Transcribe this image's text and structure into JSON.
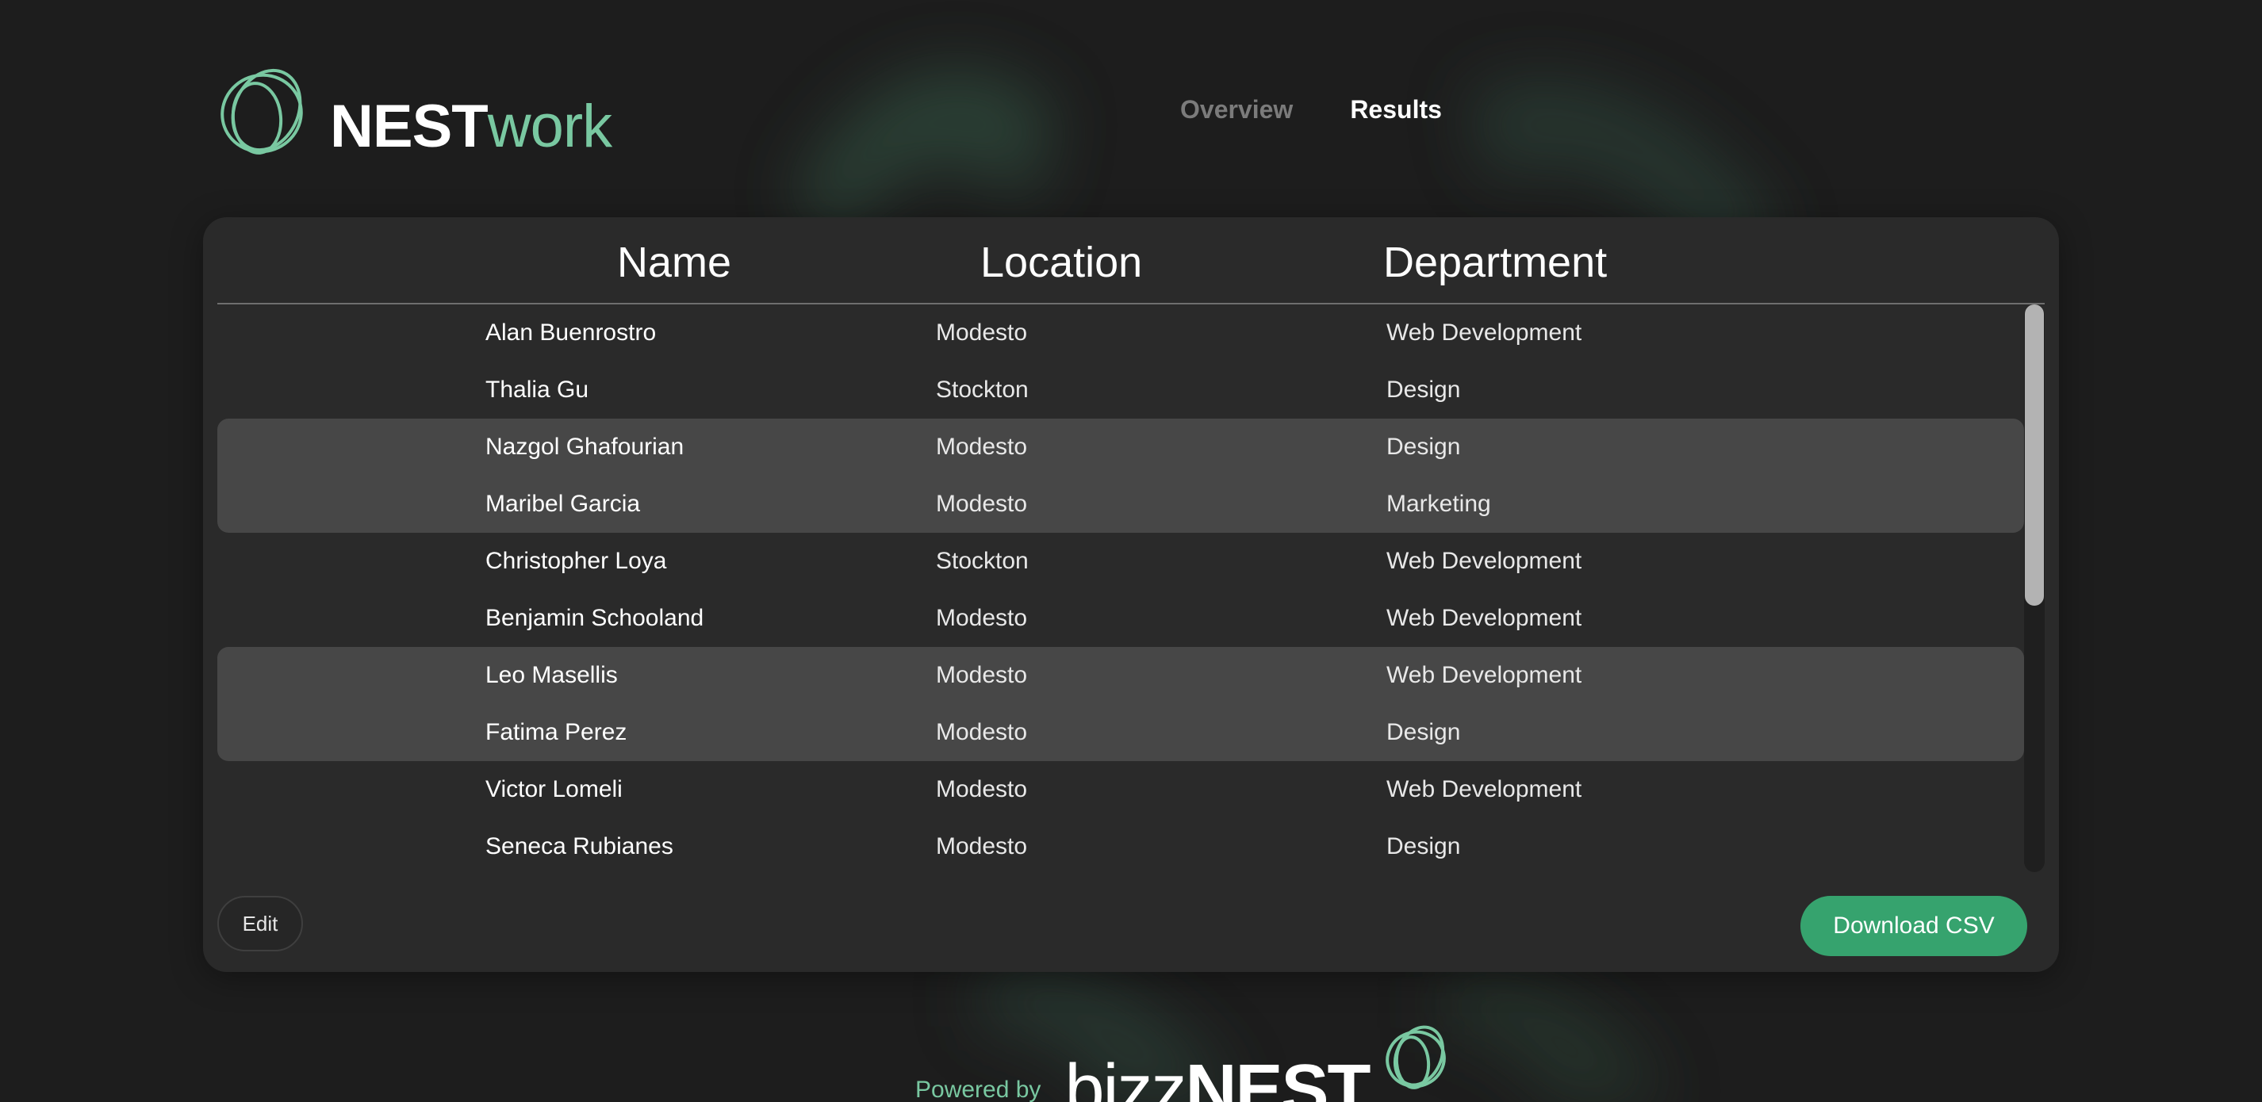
{
  "app": {
    "brand_primary": "NEST",
    "brand_secondary": "work",
    "accent_color": "#79c8a1",
    "logo_icon": "nest-scribble-logo-icon"
  },
  "nav": {
    "tabs": [
      {
        "label": "Overview",
        "active": false
      },
      {
        "label": "Results",
        "active": true
      }
    ]
  },
  "table": {
    "columns": [
      "Name",
      "Location",
      "Department"
    ],
    "rows": [
      {
        "name": "Alan Buenrostro",
        "location": "Modesto",
        "department": "Web Development"
      },
      {
        "name": "Thalia Gu",
        "location": "Stockton",
        "department": "Design"
      },
      {
        "name": "Nazgol Ghafourian",
        "location": "Modesto",
        "department": "Design"
      },
      {
        "name": "Maribel Garcia",
        "location": "Modesto",
        "department": "Marketing"
      },
      {
        "name": "Christopher Loya",
        "location": "Stockton",
        "department": "Web Development"
      },
      {
        "name": "Benjamin Schooland",
        "location": "Modesto",
        "department": "Web Development"
      },
      {
        "name": "Leo Masellis",
        "location": "Modesto",
        "department": "Web Development"
      },
      {
        "name": "Fatima Perez",
        "location": "Modesto",
        "department": "Design"
      },
      {
        "name": "Victor Lomeli",
        "location": "Modesto",
        "department": "Web Development"
      },
      {
        "name": "Seneca Rubianes",
        "location": "Modesto",
        "department": "Design"
      }
    ]
  },
  "actions": {
    "edit_label": "Edit",
    "download_label": "Download CSV",
    "download_color": "#36a36e"
  },
  "footer": {
    "powered_by": "Powered by",
    "brand_light": "bizz",
    "brand_bold": "NEST"
  }
}
